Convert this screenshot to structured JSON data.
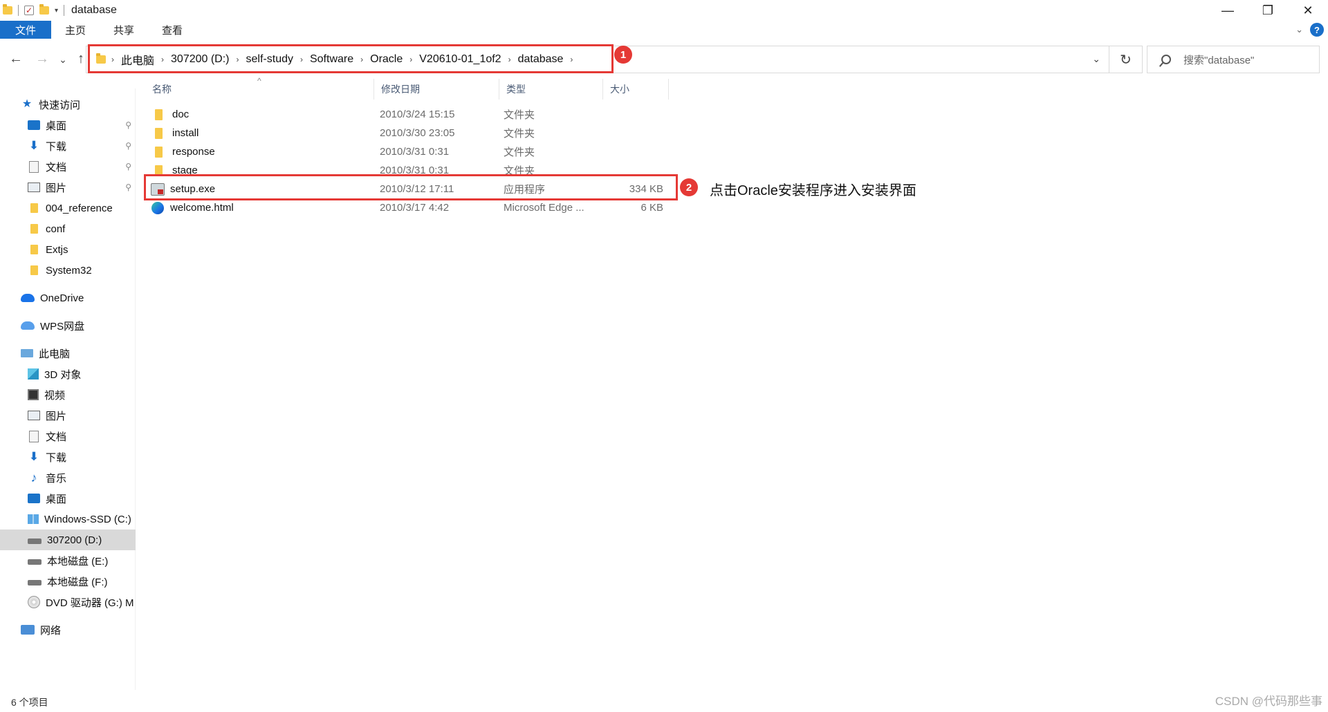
{
  "window": {
    "title": "database",
    "controls": {
      "minimize": "—",
      "restore": "❐",
      "close": "✕"
    }
  },
  "ribbon": {
    "tabs": [
      "文件",
      "主页",
      "共享",
      "查看"
    ],
    "help": "?"
  },
  "nav": {
    "back": "←",
    "forward": "→",
    "recent": "⌄",
    "up": "↑",
    "breadcrumb": [
      "此电脑",
      "307200 (D:)",
      "self-study",
      "Software",
      "Oracle",
      "V20610-01_1of2",
      "database"
    ],
    "refresh": "↻",
    "search_placeholder": "搜索\"database\""
  },
  "annotations": {
    "badge1": "1",
    "badge2": "2",
    "note2": "点击Oracle安装程序进入安装界面",
    "color": "#e53935"
  },
  "sidebar": {
    "quick_access": "快速访问",
    "quick_items": [
      {
        "label": "桌面",
        "icon": "desktop-icon",
        "pinned": true
      },
      {
        "label": "下载",
        "icon": "download-icon",
        "pinned": true
      },
      {
        "label": "文档",
        "icon": "document-icon",
        "pinned": true
      },
      {
        "label": "图片",
        "icon": "pictures-icon",
        "pinned": true
      },
      {
        "label": "004_reference",
        "icon": "folder-icon"
      },
      {
        "label": "conf",
        "icon": "folder-icon"
      },
      {
        "label": "Extjs",
        "icon": "folder-icon"
      },
      {
        "label": "System32",
        "icon": "folder-icon"
      }
    ],
    "onedrive": "OneDrive",
    "wps": "WPS网盘",
    "this_pc": "此电脑",
    "pc_items": [
      {
        "label": "3D 对象",
        "icon": "3d-objects-icon"
      },
      {
        "label": "视频",
        "icon": "video-icon"
      },
      {
        "label": "图片",
        "icon": "pictures-icon"
      },
      {
        "label": "文档",
        "icon": "document-icon"
      },
      {
        "label": "下载",
        "icon": "download-icon"
      },
      {
        "label": "音乐",
        "icon": "music-icon"
      },
      {
        "label": "桌面",
        "icon": "desktop-icon"
      },
      {
        "label": "Windows-SSD (C:)",
        "icon": "windows-drive-icon"
      },
      {
        "label": "307200 (D:)",
        "icon": "drive-icon",
        "selected": true
      },
      {
        "label": "本地磁盘 (E:)",
        "icon": "drive-icon"
      },
      {
        "label": "本地磁盘 (F:)",
        "icon": "drive-icon"
      },
      {
        "label": "DVD 驱动器 (G:) M",
        "icon": "dvd-icon"
      }
    ],
    "network": "网络"
  },
  "filelist": {
    "columns": {
      "name": "名称",
      "date": "修改日期",
      "type": "类型",
      "size": "大小"
    },
    "rows": [
      {
        "name": "doc",
        "date": "2010/3/24 15:15",
        "type": "文件夹",
        "size": "",
        "icon": "folder-icon"
      },
      {
        "name": "install",
        "date": "2010/3/30 23:05",
        "type": "文件夹",
        "size": "",
        "icon": "folder-icon"
      },
      {
        "name": "response",
        "date": "2010/3/31 0:31",
        "type": "文件夹",
        "size": "",
        "icon": "folder-icon"
      },
      {
        "name": "stage",
        "date": "2010/3/31 0:31",
        "type": "文件夹",
        "size": "",
        "icon": "folder-icon"
      },
      {
        "name": "setup.exe",
        "date": "2010/3/12 17:11",
        "type": "应用程序",
        "size": "334 KB",
        "icon": "exe-icon"
      },
      {
        "name": "welcome.html",
        "date": "2010/3/17 4:42",
        "type": "Microsoft Edge ...",
        "size": "6 KB",
        "icon": "edge-icon"
      }
    ]
  },
  "status": {
    "count": "6 个项目"
  },
  "watermark": "CSDN @代码那些事"
}
